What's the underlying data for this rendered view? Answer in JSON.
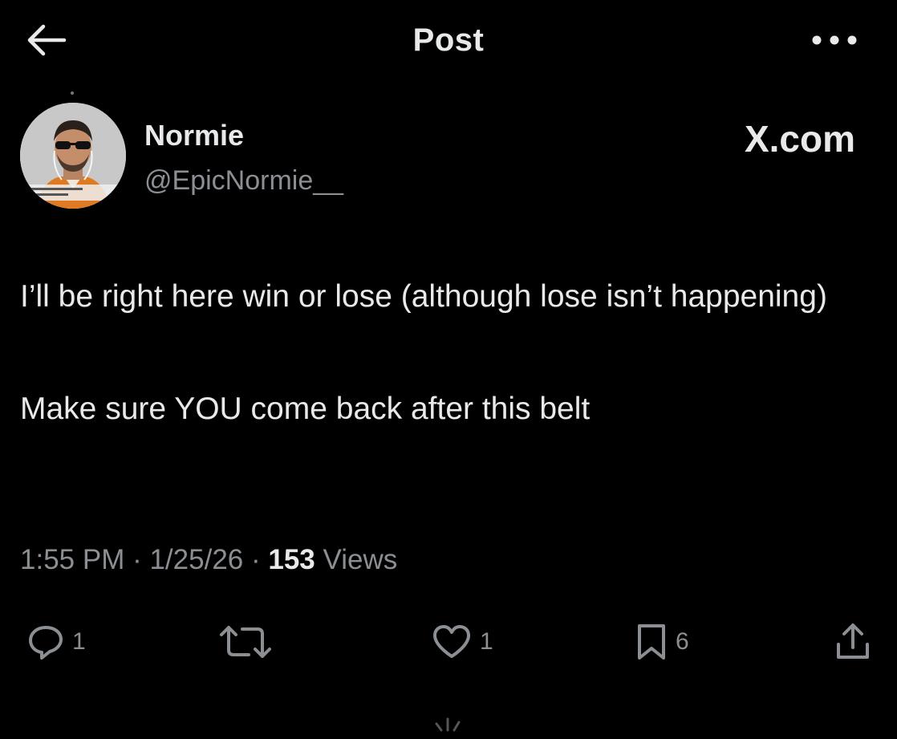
{
  "header": {
    "title": "Post",
    "back_icon": "arrow-left-icon",
    "more_icon": "more-horizontal-icon"
  },
  "post": {
    "author": {
      "name": "Normie",
      "handle": "@EpicNormie__"
    },
    "watermark": "X.com",
    "paragraphs": [
      "I’ll be right here win or lose (although lose isn’t happening)",
      "Make sure YOU come back after this belt"
    ],
    "meta": {
      "time": "1:55 PM",
      "separator": " · ",
      "date": "1/25/26",
      "views_count": "153",
      "views_label": " Views"
    }
  },
  "actions": {
    "reply": {
      "icon": "reply-icon",
      "count": "1"
    },
    "repost": {
      "icon": "repost-icon"
    },
    "like": {
      "icon": "heart-icon",
      "count": "1"
    },
    "bookmark": {
      "icon": "bookmark-icon",
      "count": "6"
    },
    "share": {
      "icon": "share-icon"
    }
  },
  "colors": {
    "background": "#000000",
    "text_primary": "#e7e9ea",
    "text_secondary": "#8b8f94"
  }
}
